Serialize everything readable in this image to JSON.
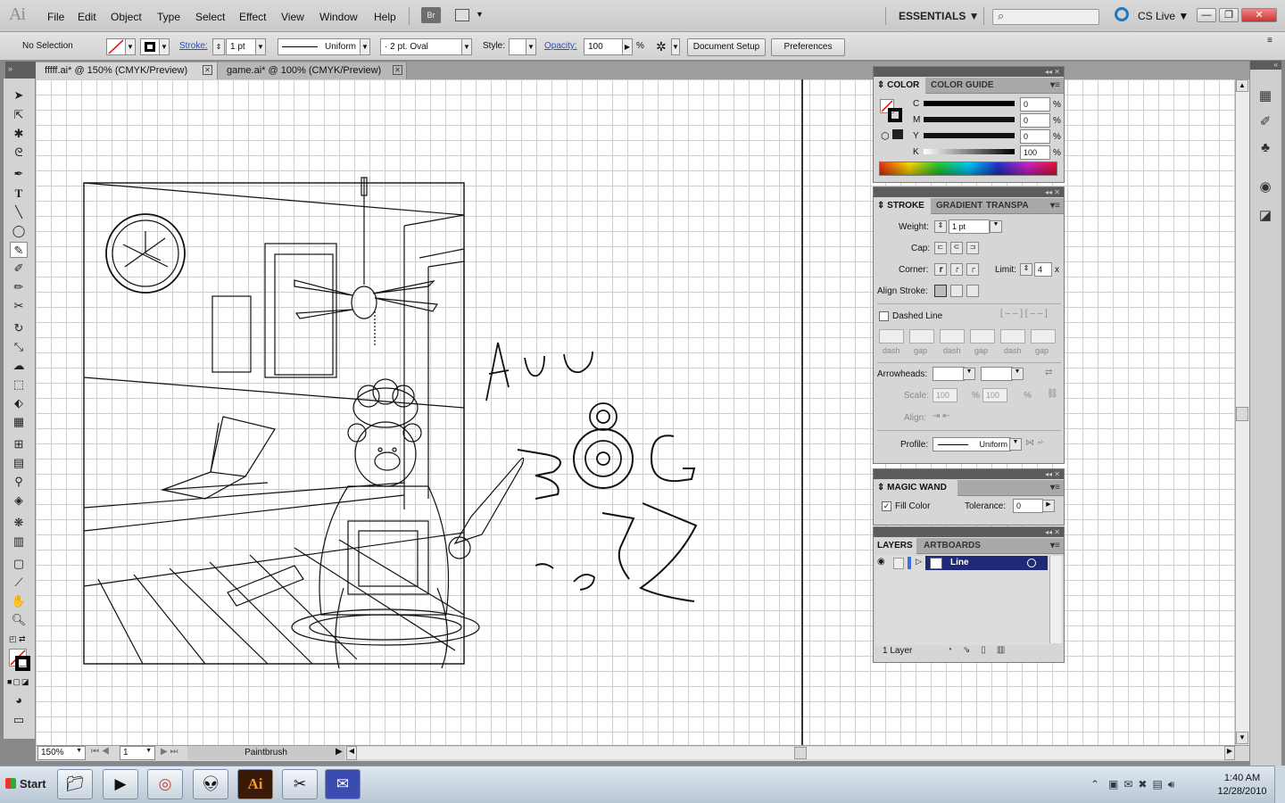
{
  "app": {
    "logo": "Ai"
  },
  "menu": [
    "File",
    "Edit",
    "Object",
    "Type",
    "Select",
    "Effect",
    "View",
    "Window",
    "Help"
  ],
  "menubar": {
    "bridge": "Br",
    "workspace": "ESSENTIALS ▼",
    "cs_live": "CS Live ▼",
    "search_placeholder": ""
  },
  "window_buttons": {
    "minimize": "—",
    "restore": "❐",
    "close": "✕"
  },
  "control": {
    "selection": "No Selection",
    "stroke_label": "Stroke:",
    "stroke_value": "1 pt",
    "profile": "Uniform",
    "brush": "·   2 pt. Oval",
    "style_label": "Style:",
    "opacity_label": "Opacity:",
    "opacity_value": "100",
    "percent": "%",
    "document_setup": "Document Setup",
    "preferences": "Preferences"
  },
  "tabs": [
    {
      "label": "fffff.ai* @ 150% (CMYK/Preview)",
      "active": true
    },
    {
      "label": "game.ai* @ 100% (CMYK/Preview)",
      "active": false
    }
  ],
  "color_panel": {
    "tabs": [
      "COLOR",
      "COLOR GUIDE"
    ],
    "channels": [
      {
        "name": "C",
        "value": "0"
      },
      {
        "name": "M",
        "value": "0"
      },
      {
        "name": "Y",
        "value": "0"
      },
      {
        "name": "K",
        "value": "100"
      }
    ],
    "percent": "%"
  },
  "stroke_panel": {
    "tabs": [
      "STROKE",
      "GRADIENT",
      "TRANSPA"
    ],
    "weight_label": "Weight:",
    "weight_value": "1 pt",
    "cap_label": "Cap:",
    "corner_label": "Corner:",
    "limit_label": "Limit:",
    "limit_value": "4",
    "limit_unit": "x",
    "align_label": "Align Stroke:",
    "dashed_label": "Dashed Line",
    "dash_labels": [
      "dash",
      "gap",
      "dash",
      "gap",
      "dash",
      "gap"
    ],
    "arrowheads_label": "Arrowheads:",
    "scale_label": "Scale:",
    "scale_values": [
      "100",
      "100"
    ],
    "align2_label": "Align:",
    "profile_label": "Profile:",
    "profile_value": "Uniform"
  },
  "magic_wand": {
    "title": "MAGIC WAND",
    "fill_color": "Fill Color",
    "fill_checked": true,
    "tolerance_label": "Tolerance:",
    "tolerance_value": "0"
  },
  "layers_panel": {
    "tabs": [
      "LAYERS",
      "ARTBOARDS"
    ],
    "layers": [
      {
        "name": "Line"
      }
    ],
    "count": "1 Layer"
  },
  "status": {
    "zoom": "150%",
    "page": "1",
    "tool": "Paintbrush"
  },
  "taskbar": {
    "start": "Start",
    "time": "1:40 AM",
    "date": "12/28/2010",
    "ai_label": "Ai"
  },
  "colors": {
    "accent": "#1b78c2",
    "layer_highlight": "#1e2a78",
    "ai_orange": "#f29a1f"
  }
}
